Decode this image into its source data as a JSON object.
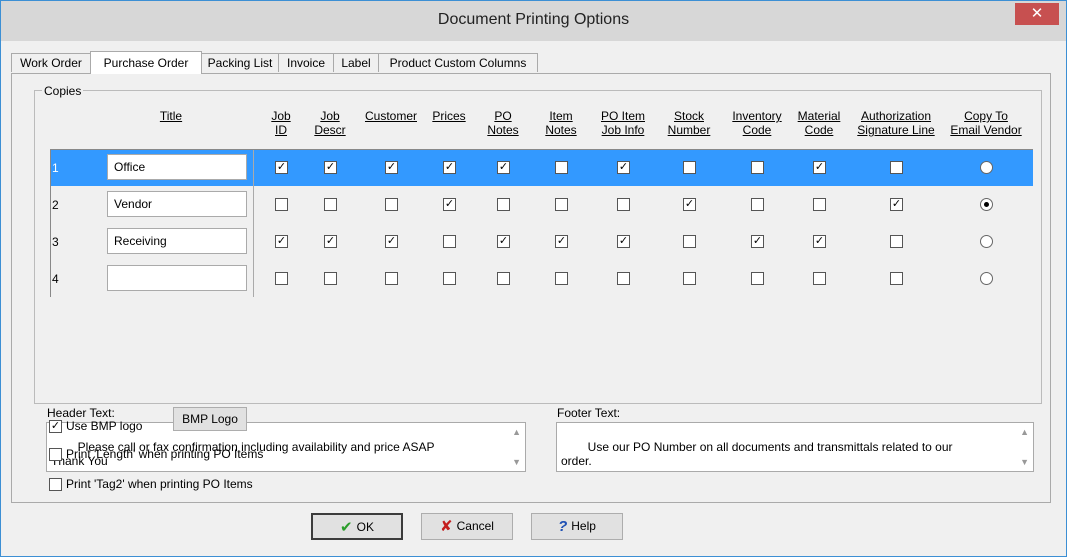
{
  "window": {
    "title": "Document Printing Options",
    "close_label": "✕"
  },
  "tabs": [
    {
      "label": "Work Order",
      "active": false
    },
    {
      "label": "Purchase Order",
      "active": true
    },
    {
      "label": "Packing List",
      "active": false
    },
    {
      "label": "Invoice",
      "active": false
    },
    {
      "label": "Label",
      "active": false
    },
    {
      "label": "Product Custom Columns",
      "active": false
    }
  ],
  "copies": {
    "group_label": "Copies",
    "title_header": "Title",
    "columns": [
      {
        "line1": "Job",
        "line2": "ID"
      },
      {
        "line1": "Job",
        "line2": "Descr"
      },
      {
        "line1": "Customer",
        "line2": ""
      },
      {
        "line1": "Prices",
        "line2": ""
      },
      {
        "line1": "PO",
        "line2": "Notes"
      },
      {
        "line1": "Item",
        "line2": "Notes"
      },
      {
        "line1": "PO Item",
        "line2": "Job Info"
      },
      {
        "line1": "Stock",
        "line2": "Number"
      },
      {
        "line1": "Inventory",
        "line2": "Code"
      },
      {
        "line1": "Material",
        "line2": "Code"
      },
      {
        "line1": "Authorization",
        "line2": "Signature Line"
      },
      {
        "line1": "Copy To",
        "line2": "Email Vendor"
      }
    ],
    "rows": [
      {
        "num": "1",
        "title": "Office",
        "selected": true,
        "checks": [
          true,
          true,
          true,
          true,
          true,
          false,
          true,
          false,
          false,
          true,
          false
        ],
        "email_vendor": false
      },
      {
        "num": "2",
        "title": "Vendor",
        "selected": false,
        "checks": [
          false,
          false,
          false,
          true,
          false,
          false,
          false,
          true,
          false,
          false,
          true
        ],
        "email_vendor": true
      },
      {
        "num": "3",
        "title": "Receiving",
        "selected": false,
        "checks": [
          true,
          true,
          true,
          false,
          true,
          true,
          true,
          false,
          true,
          true,
          false
        ],
        "email_vendor": false
      },
      {
        "num": "4",
        "title": "",
        "selected": false,
        "checks": [
          false,
          false,
          false,
          false,
          false,
          false,
          false,
          false,
          false,
          false,
          false
        ],
        "email_vendor": false
      }
    ]
  },
  "header_text": {
    "label": "Header Text:",
    "value": "Please call or fax confirmation including availability and price ASAP\nThank You"
  },
  "footer_text": {
    "label": "Footer Text:",
    "value": "Use our PO Number on all documents and transmittals related to our\norder."
  },
  "options": {
    "use_bmp_logo": {
      "label": "Use BMP logo",
      "checked": true
    },
    "bmp_logo_button": "BMP Logo",
    "print_length": {
      "label": "Print 'Length' when printing PO Items",
      "checked": false
    },
    "print_tag2": {
      "label": "Print 'Tag2' when printing PO Items",
      "checked": false
    }
  },
  "buttons": {
    "ok": "OK",
    "cancel": "Cancel",
    "help": "Help"
  },
  "colors": {
    "selection": "#3399ff",
    "close": "#c75050",
    "ok_icon": "#2a9d2a",
    "cancel_icon": "#c41e1e",
    "help_icon": "#1e50b4"
  }
}
